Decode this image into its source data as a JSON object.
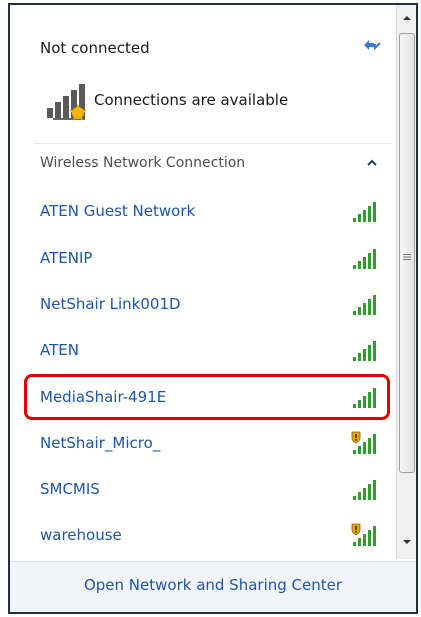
{
  "header": {
    "status_text": "Not connected",
    "availability_text": "Connections are available"
  },
  "section": {
    "title": "Wireless Network Connection"
  },
  "networks": [
    {
      "name": "ATEN Guest Network",
      "secured_warning": false,
      "selected": false
    },
    {
      "name": "ATENIP",
      "secured_warning": false,
      "selected": false
    },
    {
      "name": "NetShair Link001D",
      "secured_warning": false,
      "selected": false
    },
    {
      "name": "ATEN",
      "secured_warning": false,
      "selected": false
    },
    {
      "name": "MediaShair-491E",
      "secured_warning": false,
      "selected": true
    },
    {
      "name": "NetShair_Micro_",
      "secured_warning": true,
      "selected": false
    },
    {
      "name": "SMCMIS",
      "secured_warning": false,
      "selected": false
    },
    {
      "name": "warehouse",
      "secured_warning": true,
      "selected": false
    }
  ],
  "footer": {
    "link_text": "Open Network and Sharing Center"
  },
  "colors": {
    "link": "#1e55a8",
    "highlight": "#e00000",
    "signal": "#2e9e2e"
  },
  "icons": {
    "refresh": "refresh-icon",
    "availability": "network-available-icon",
    "collapse": "chevron-up-icon",
    "signal": "signal-strength-icon",
    "warning": "shield-warning-icon"
  }
}
